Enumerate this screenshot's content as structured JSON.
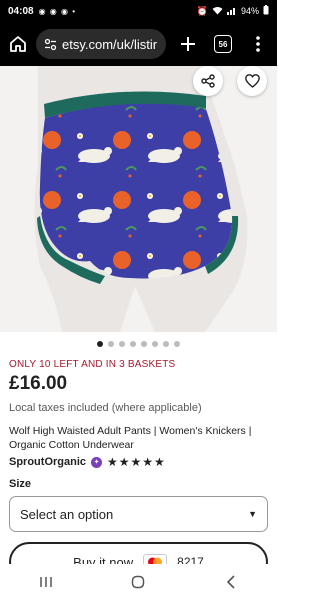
{
  "status_bar": {
    "time": "04:08",
    "notification_icons": "◉ ◉ ◉ •",
    "battery": "94%"
  },
  "browser": {
    "url": "etsy.com/uk/listir",
    "tab_count": "56"
  },
  "product": {
    "image_alt": "Wolf print high waisted underwear",
    "image_count": 8,
    "active_image": 0,
    "stock_note": "ONLY 10 LEFT AND IN 3 BASKETS",
    "price": "£16.00",
    "tax_note": "Local taxes included (where applicable)",
    "title": "Wolf High Waisted Adult Pants | Women's Knickers | Organic Cotton Underwear",
    "shop_name": "SproutOrganic",
    "rating_stars": "★★★★★",
    "rating": 5
  },
  "size": {
    "label": "Size",
    "placeholder": "Select an option"
  },
  "buy": {
    "label": "Buy it now",
    "card_number": "8217"
  },
  "colors": {
    "stock_red": "#a61a2e",
    "fabric_blue": "#3d3fa6",
    "band_green": "#1e6b5e",
    "star_seller_purple": "#7b3fb8"
  }
}
